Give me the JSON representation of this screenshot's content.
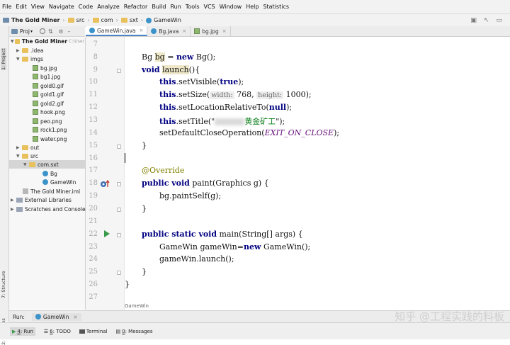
{
  "menu": [
    "File",
    "Edit",
    "View",
    "Navigate",
    "Code",
    "Analyze",
    "Refactor",
    "Build",
    "Run",
    "Tools",
    "VCS",
    "Window",
    "Help",
    "Statistics"
  ],
  "breadcrumb": [
    "The Gold Miner",
    "src",
    "com",
    "sxt",
    "GameWin"
  ],
  "left_strip": {
    "project": "1: Project",
    "structure": "7: Structure",
    "favorites": "2: Favorites"
  },
  "project_panel": {
    "title": "Proj",
    "tree": [
      {
        "label": "The Gold Miner",
        "suffix": "C:\\User",
        "icon": "project-folder-icon",
        "depth": 0,
        "expanded": true,
        "bold": true
      },
      {
        "label": ".idea",
        "icon": "folder-icon",
        "depth": 1,
        "expanded": false
      },
      {
        "label": "imgs",
        "icon": "folder-icon",
        "depth": 1,
        "expanded": true
      },
      {
        "label": "bg.jpg",
        "icon": "image-file-icon",
        "depth": 2
      },
      {
        "label": "bg1.jpg",
        "icon": "image-file-icon",
        "depth": 2
      },
      {
        "label": "gold0.gif",
        "icon": "image-file-icon",
        "depth": 2
      },
      {
        "label": "gold1.gif",
        "icon": "image-file-icon",
        "depth": 2
      },
      {
        "label": "gold2.gif",
        "icon": "image-file-icon",
        "depth": 2
      },
      {
        "label": "hook.png",
        "icon": "image-file-icon",
        "depth": 2
      },
      {
        "label": "peo.png",
        "icon": "image-file-icon",
        "depth": 2
      },
      {
        "label": "rock1.png",
        "icon": "image-file-icon",
        "depth": 2
      },
      {
        "label": "water.png",
        "icon": "image-file-icon",
        "depth": 2
      },
      {
        "label": "out",
        "icon": "folder-icon",
        "depth": 1,
        "expanded": false
      },
      {
        "label": "src",
        "icon": "folder-icon",
        "depth": 1,
        "expanded": true
      },
      {
        "label": "com.sxt",
        "icon": "folder-icon",
        "depth": 2,
        "expanded": true,
        "selected": true
      },
      {
        "label": "Bg",
        "icon": "class-icon",
        "depth": 3
      },
      {
        "label": "GameWin",
        "icon": "class-icon",
        "depth": 3
      },
      {
        "label": "The Gold Miner.iml",
        "icon": "iml-file-icon",
        "depth": 1
      },
      {
        "label": "External Libraries",
        "icon": "library-icon",
        "depth": 0,
        "expanded": false
      },
      {
        "label": "Scratches and Consoles",
        "icon": "scratches-icon",
        "depth": 0,
        "expanded": false
      }
    ]
  },
  "tabs": [
    {
      "label": "GameWin.java",
      "active": true,
      "icon": "class-icon"
    },
    {
      "label": "Bg.java",
      "active": false,
      "icon": "class-icon"
    },
    {
      "label": "bg.jpg",
      "active": false,
      "icon": "image-file-icon"
    }
  ],
  "editor": {
    "line_numbers": [
      "7",
      "8",
      "9",
      "10",
      "11",
      "12",
      "13",
      "14",
      "15",
      "16",
      "17",
      "18",
      "19",
      "20",
      "21",
      "22",
      "23",
      "24",
      "25",
      "26",
      "27"
    ],
    "lines": {
      "l8": {
        "type": "Bg",
        "var": "bg",
        "rest": " = ",
        "kw": "new",
        "call": " Bg();"
      },
      "l9": {
        "kw": "void",
        "name": "launch",
        "rest": "(){"
      },
      "l10": {
        "kw": "this",
        "rest": ".setVisible(",
        "kw2": "true",
        "end": ");"
      },
      "l11": {
        "kw": "this",
        "rest": ".setSize(",
        "hint1": "width:",
        "v1": " 768, ",
        "hint2": "height:",
        "v2": " 1000);"
      },
      "l12": {
        "kw": "this",
        "rest": ".setLocationRelativeTo(",
        "kw2": "null",
        "end": ");"
      },
      "l13": {
        "kw": "this",
        "rest": ".setTitle(\"",
        "title_text": "黄金矿工",
        "end": "\");"
      },
      "l14": {
        "rest": "setDefaultCloseOperation(",
        "const": "EXIT_ON_CLOSE",
        "end": ");"
      },
      "l15": {
        "rest": "}"
      },
      "l17": {
        "ann": "@Override"
      },
      "l18": {
        "kw": "public void",
        "rest": " paint(Graphics g) {"
      },
      "l19": {
        "rest": "bg.paintSelf(g);"
      },
      "l20": {
        "rest": "}"
      },
      "l22": {
        "kw": "public static void",
        "rest": " main(String[] args) {"
      },
      "l23": {
        "pre": "GameWin gameWin=",
        "kw": "new",
        "rest": " GameWin();"
      },
      "l24": {
        "rest": "gameWin.launch();"
      },
      "l25": {
        "rest": "}"
      },
      "l26": {
        "rest": "}"
      }
    },
    "footer_crumb": "GameWin"
  },
  "run_bar": {
    "label": "Run:",
    "config": "GameWin"
  },
  "status_bar": [
    {
      "key": "4",
      "label": ": Run"
    },
    {
      "key": "6",
      "label": ": TODO"
    },
    {
      "key": "",
      "label": "Terminal"
    },
    {
      "key": "0",
      "label": ": Messages"
    }
  ],
  "watermark": "知乎 @工程实践的料板",
  "colors": {
    "keyword": "#000080",
    "annotation": "#808000",
    "constant": "#660e7a",
    "current_line": "#fdf9e6",
    "accent": "#4a86c8"
  }
}
